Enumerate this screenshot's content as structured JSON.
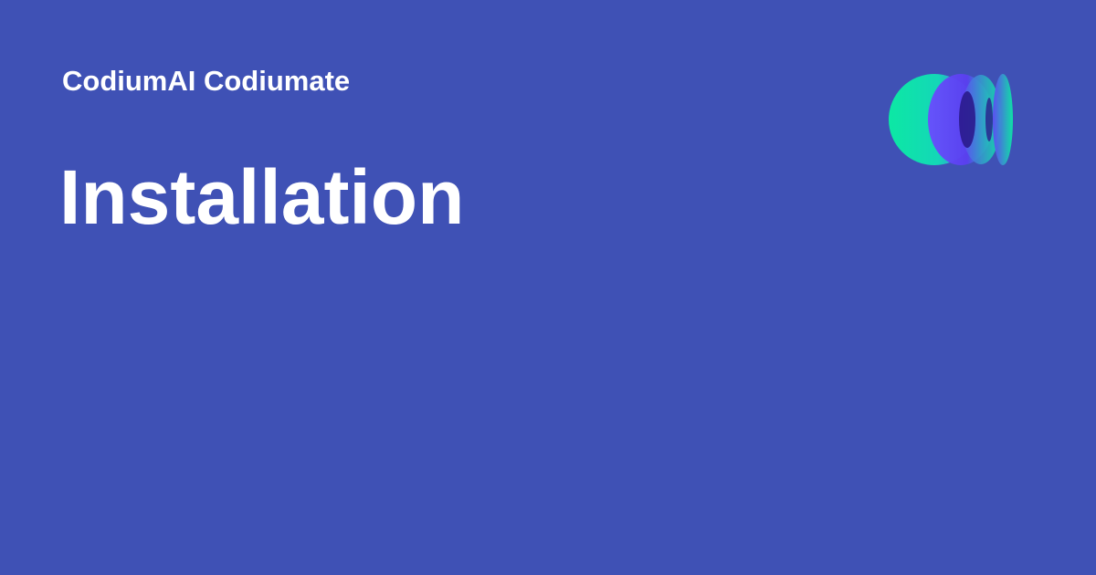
{
  "brand": {
    "site_name": "CodiumAI Codiumate",
    "logo_icon": "codiumai-logo-icon"
  },
  "page": {
    "title": "Installation"
  },
  "colors": {
    "background": "#3f51b5",
    "text": "#ffffff",
    "logo_green": "#0ce8a4",
    "logo_purple": "#6a4cff",
    "logo_dark": "#2a1a8c"
  }
}
